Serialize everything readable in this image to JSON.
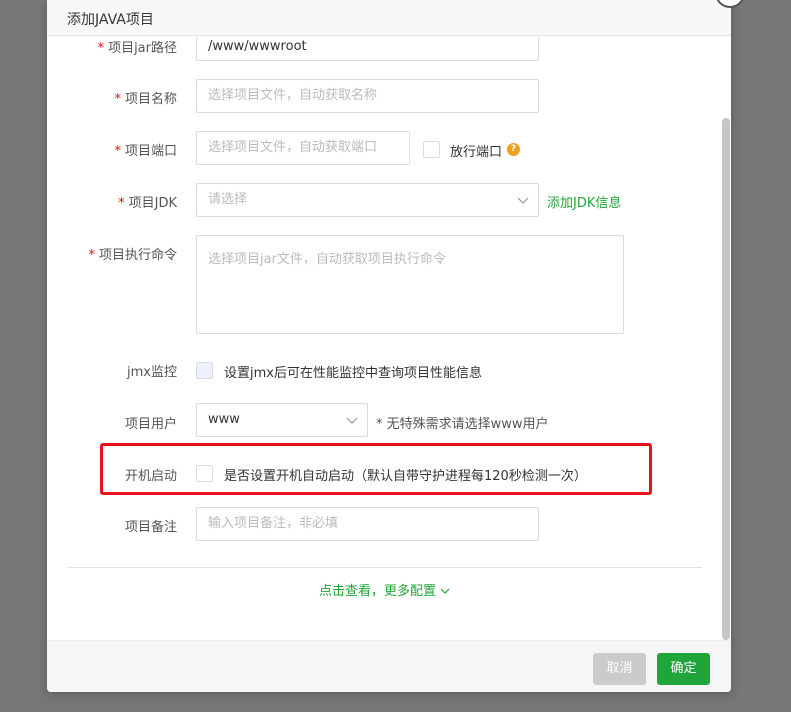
{
  "dialog": {
    "title": "添加JAVA项目",
    "accent_color": "#20a53a",
    "required_mark": "*"
  },
  "form": {
    "jar_path": {
      "label": "项目jar路径",
      "value": "/www/wwwroot",
      "icon": "folder-icon"
    },
    "name": {
      "label": "项目名称",
      "placeholder": "选择项目文件，自动获取名称"
    },
    "port": {
      "label": "项目端口",
      "placeholder": "选择项目文件，自动获取端口",
      "release_label": "放行端口",
      "help": "?"
    },
    "jdk": {
      "label": "项目JDK",
      "placeholder": "请选择",
      "add_link": "添加JDK信息"
    },
    "command": {
      "label": "项目执行命令",
      "placeholder": "选择项目jar文件，自动获取项目执行命令"
    },
    "jmx": {
      "label": "jmx监控",
      "checkbox_label": "设置jmx后可在性能监控中查询项目性能信息"
    },
    "user": {
      "label": "项目用户",
      "value": "www",
      "hint": "* 无特殊需求请选择www用户"
    },
    "autostart": {
      "label": "开机启动",
      "checkbox_label": "是否设置开机自动启动（默认自带守护进程每120秒检测一次）"
    },
    "remark": {
      "label": "项目备注",
      "placeholder": "输入项目备注，非必填"
    },
    "more_link": "点击查看，更多配置"
  },
  "footer": {
    "cancel_label": "取消",
    "ok_label": "确定"
  }
}
